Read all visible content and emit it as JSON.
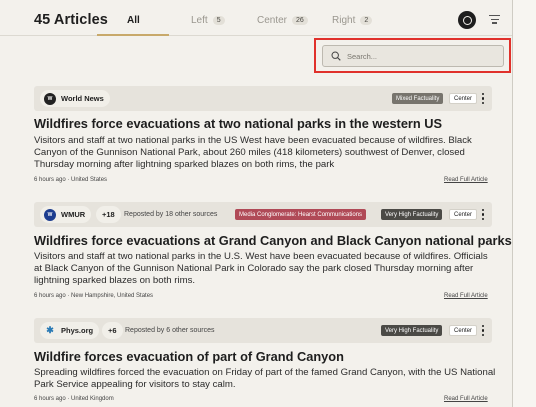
{
  "header": {
    "count": "45 Articles",
    "tabs": [
      {
        "label": "All",
        "count": null
      },
      {
        "label": "Left",
        "count": "5"
      },
      {
        "label": "Center",
        "count": "26"
      },
      {
        "label": "Right",
        "count": "2"
      }
    ]
  },
  "search": {
    "placeholder": "Search..."
  },
  "articles": [
    {
      "source": "World News",
      "logo": "W",
      "tags": [
        "Mixed Factuality",
        "Center"
      ],
      "headline": "Wildfires force evacuations at two national parks in the western US",
      "summary": "Visitors and staff at two national parks in the US West have been evacuated because of wildfires. Black Canyon of the Gunnison National Park, about 260 miles (418 kilometers) southwest of Denver, closed Thursday morning after lightning sparked blazes on both rims, the park",
      "meta": "6 hours ago · United States",
      "read": "Read Full Article"
    },
    {
      "source": "WMUR",
      "logo": "W",
      "plus": "+18",
      "repost": "Reposted by 18 other sources",
      "tags": [
        "Media Conglomerate: Hearst Communications",
        "Very High Factuality",
        "Center"
      ],
      "headline": "Wildfires force evacuations at Grand Canyon and Black Canyon national parks",
      "summary": "Visitors and staff at two national parks in the U.S. West have been evacuated because of wildfires. Officials at Black Canyon of the Gunnison National Park in Colorado say the park closed Thursday morning after lightning sparked blazes on both rims.",
      "meta": "6 hours ago · New Hampshire, United States",
      "read": "Read Full Article"
    },
    {
      "source": "Phys.org",
      "logo": "✱",
      "plus": "+6",
      "repost": "Reposted by 6 other sources",
      "tags": [
        "Very High Factuality",
        "Center"
      ],
      "headline": "Wildfire forces evacuation of part of Grand Canyon",
      "summary": "Spreading wildfires forced the evacuation on Friday of part of the famed Grand Canyon, with the US National Park Service appealing for visitors to stay calm.",
      "meta": "6 hours ago · United Kingdom",
      "read": "Read Full Article"
    }
  ]
}
